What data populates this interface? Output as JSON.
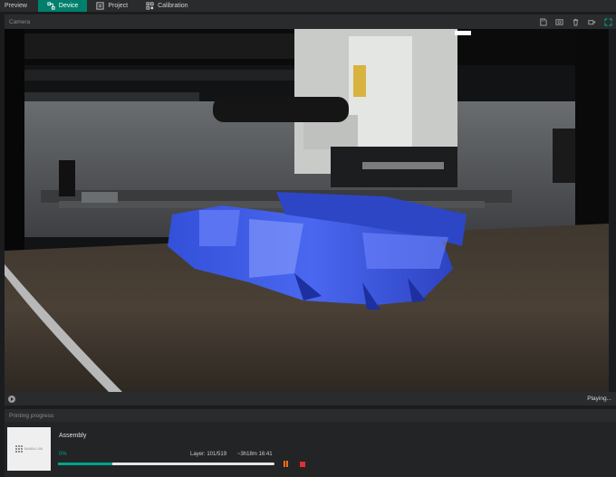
{
  "nav": {
    "preview_label": "Preview",
    "device_label": "Device",
    "project_label": "Project",
    "calibration_label": "Calibration"
  },
  "camera": {
    "title": "Camera",
    "status": "Playing...",
    "header_icons": [
      "sd-card-icon",
      "timelapse-icon",
      "delete-icon",
      "video-icon",
      "maximize-icon"
    ]
  },
  "progress": {
    "title": "Printing progress",
    "job_name": "Assembly",
    "percent_label": "0%",
    "percent": 25,
    "layer_label": "Layer: 101/519",
    "eta_label": "~3h18m  16:41",
    "thumbnail_caption": "BAMBU LAB"
  },
  "colors": {
    "accent": "#00806c",
    "progress": "#00a38a",
    "pause": "#ff6f1a",
    "stop": "#e03030"
  }
}
